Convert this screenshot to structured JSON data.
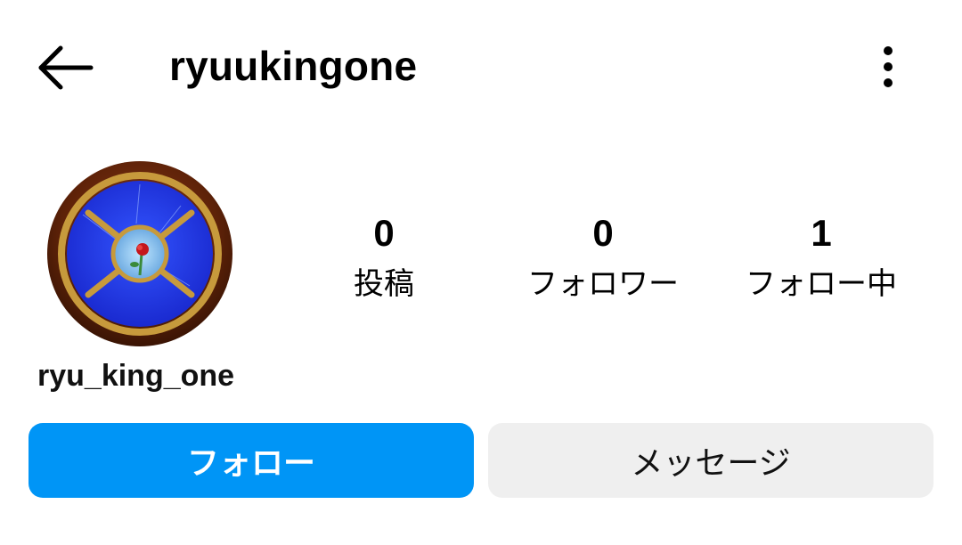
{
  "header": {
    "back_icon": "arrow-left-icon",
    "title": "ryuukingone",
    "more_icon": "more-vertical-icon"
  },
  "profile": {
    "avatar": "stained-glass-rose-window",
    "display_name": "ryu_king_one"
  },
  "stats": [
    {
      "value": "0",
      "label": "投稿"
    },
    {
      "value": "0",
      "label": "フォロワー"
    },
    {
      "value": "1",
      "label": "フォロー中"
    }
  ],
  "actions": {
    "follow_label": "フォロー",
    "message_label": "メッセージ"
  },
  "colors": {
    "accent": "#0095f6",
    "secondary_button": "#efefef"
  }
}
